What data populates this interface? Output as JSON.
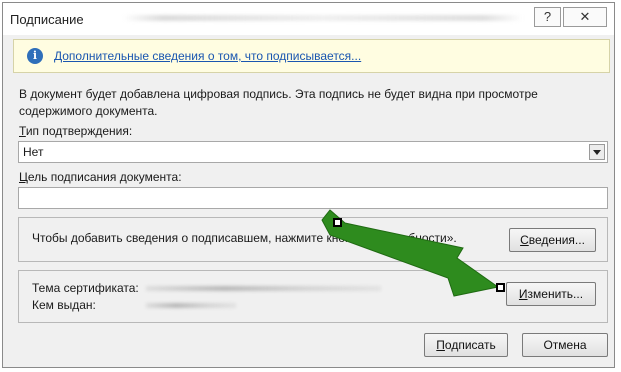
{
  "window": {
    "title": "Подписание",
    "help_label": "?",
    "close_label": "✕"
  },
  "infobar": {
    "icon": "info-icon",
    "link_text": "Дополнительные сведения о том, что подписывается..."
  },
  "description": {
    "line1": "В документ будет добавлена цифровая подпись. Эта подпись не будет видна при просмотре",
    "line2": "содержимого документа."
  },
  "commitment": {
    "label_first": "Т",
    "label_rest": "ип подтверждения:",
    "selected": "Нет"
  },
  "purpose": {
    "label_first": "Ц",
    "label_rest": "ель подписания документа:",
    "value": ""
  },
  "signer_panel": {
    "text": "Чтобы добавить сведения о подписавшем, нажмите кнопку «Подробности».",
    "details_button_first": "С",
    "details_button_rest": "ведения..."
  },
  "certificate_panel": {
    "subject_label": "Тема сертификата:",
    "issuer_label": "Кем выдан:",
    "change_button_first": "И",
    "change_button_rest": "зменить..."
  },
  "footer": {
    "sign_first": "П",
    "sign_rest": "одписать",
    "cancel_label": "Отмена"
  },
  "annotation": {
    "arrow_color": "#2e8b1e"
  }
}
